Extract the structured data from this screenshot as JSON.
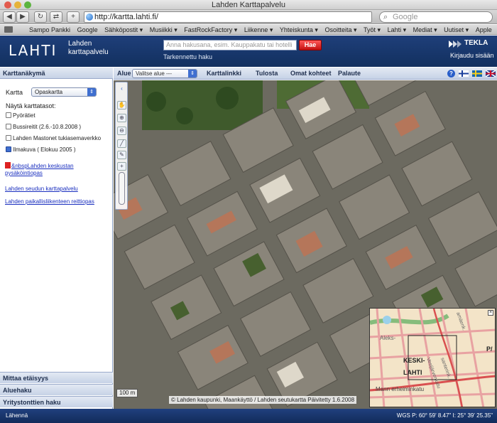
{
  "browser": {
    "window_title": "Lahden Karttapalvelu",
    "url": "http://kartta.lahti.fi/",
    "search_placeholder": "Google",
    "bookmarks": [
      "Sampo Pankki",
      "Google",
      "Sähköpostit ▾",
      "Musiikki ▾",
      "FastRockFactory ▾",
      "Liikenne ▾",
      "Yhteiskunta ▾",
      "Osoitteita ▾",
      "Työt ▾",
      "Lahti ▾",
      "Mediat ▾",
      "Uutiset ▾",
      "Apple"
    ]
  },
  "header": {
    "logo": "LAHTI",
    "subtitle_line1": "Lahden",
    "subtitle_line2": "karttapalvelu",
    "search_placeholder": "Anna hakusana, esim. Kauppakatu tai hotelli",
    "search_button": "Hae",
    "advanced_search": "Tarkennettu haku",
    "brand": "TEKLA",
    "login": "Kirjaudu sisään"
  },
  "left_panel": {
    "title": "Karttanäkymä",
    "map_label": "Kartta",
    "map_selected": "Opaskartta",
    "layers_title": "Näytä karttatasot:",
    "layers": [
      {
        "label": "Pyörätiet",
        "checked": false
      },
      {
        "label": "Bussireitit (2.6.-10.8.2008 )",
        "checked": false
      },
      {
        "label": "Lahden Mastonet tukiasemaverkko",
        "checked": false
      },
      {
        "label": "Ilmakuva ( Elokuu 2005 )",
        "checked": true
      }
    ],
    "links": {
      "pysakointi_line1": "&nbspLahden keskustan",
      "pysakointi_line2": "pysäköintiopas",
      "seutu": "Lahden seudun karttapalvelu",
      "reittiopas": "Lahden paikallisliikenteen reittiopas"
    },
    "accordion": [
      "Mittaa etäisyys",
      "Aluehaku",
      "Yritystonttien haku"
    ]
  },
  "map_toolbar": {
    "area_label": "Alue",
    "area_selected": "Valitse alue ---",
    "items": [
      "Karttalinkki",
      "Tulosta",
      "Omat kohteet",
      "Palaute"
    ],
    "help": "?"
  },
  "map": {
    "scale": "100 m",
    "copyright": "© Lahden kaupunki, Maankäyttö / Lahden seutukartta  Päivitetty 1.6.2008",
    "overview_labels": {
      "district_line1": "KESKI-",
      "district_line2": "LAHTI",
      "street1": "Aleks-",
      "street2": "Vesijärvenkatu",
      "street3": "santerink.",
      "street4": "Mann erheiminkatu",
      "street5": "amäenk.",
      "edge": "P/"
    }
  },
  "status": {
    "left": "Lähennä",
    "coords": "WGS P: 60° 59' 8.47\" I: 25° 39' 25.35\""
  },
  "colors": {
    "header_bg": "#1f3f7a",
    "panel_header": "#c6d2e6",
    "link": "#1a2fbf",
    "search_button": "#c41010"
  }
}
